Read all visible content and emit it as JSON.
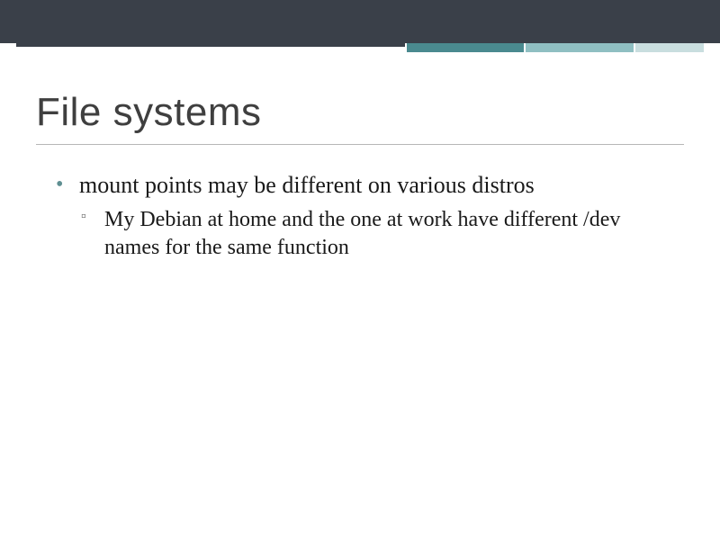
{
  "slide": {
    "title": "File systems",
    "bullets": [
      {
        "text": "mount points may be different on various distros",
        "children": [
          {
            "text": "My Debian at home and the one at work have different /dev names for the same function"
          }
        ]
      }
    ]
  },
  "theme": {
    "top_bar": "#3a4049",
    "accent_segments": [
      "#3a4049",
      "#4a8a8f",
      "#8fbfc2",
      "#c9dedf"
    ],
    "bullet_lvl1_color": "#5f8f92"
  }
}
